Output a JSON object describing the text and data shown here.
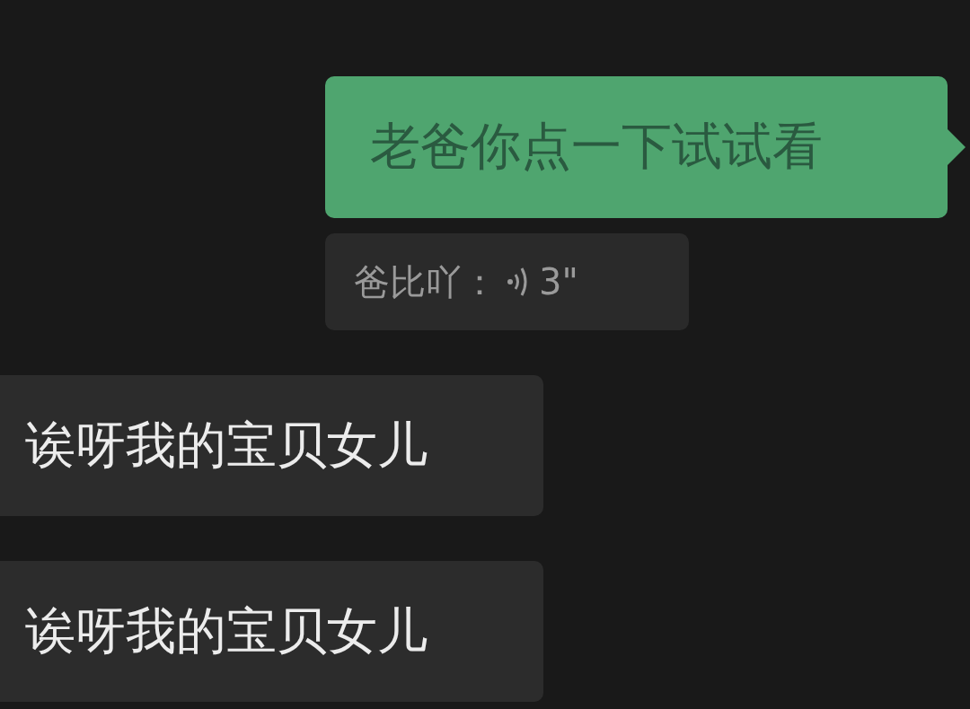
{
  "messages": [
    {
      "kind": "sent",
      "text": "老爸你点一下试试看",
      "quote": {
        "sender": "爸比吖：",
        "duration": "3\""
      }
    },
    {
      "kind": "received",
      "text": "诶呀我的宝贝女儿"
    },
    {
      "kind": "received",
      "text": "诶呀我的宝贝女儿"
    }
  ]
}
